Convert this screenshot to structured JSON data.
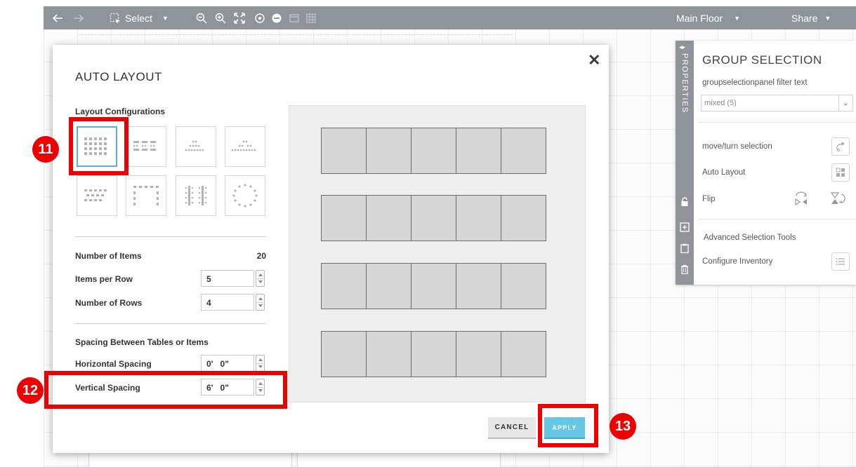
{
  "toolbar": {
    "select_label": "Select",
    "floor_label": "Main Floor",
    "share_label": "Share"
  },
  "dialog": {
    "title": "AUTO LAYOUT",
    "layout_configurations_label": "Layout Configurations",
    "number_of_items_label": "Number of Items",
    "number_of_items_value": "20",
    "items_per_row_label": "Items per Row",
    "items_per_row_value": "5",
    "number_of_rows_label": "Number of Rows",
    "number_of_rows_value": "4",
    "spacing_section_label": "Spacing Between Tables or Items",
    "horizontal_spacing_label": "Horizontal Spacing",
    "horizontal_spacing_value": "0'   0\"",
    "vertical_spacing_label": "Vertical Spacing",
    "vertical_spacing_value": "6'   0\"",
    "cancel_label": "CANCEL",
    "apply_label": "APPLY",
    "preview_rows": 4,
    "preview_columns": 5
  },
  "callouts": {
    "c11": "11",
    "c12": "12",
    "c13": "13"
  },
  "properties": {
    "tab_label": "PROPERTIES",
    "title": "GROUP SELECTION",
    "filter_label": "groupselectionpanel filter text",
    "select_value": "mixed (5)",
    "move_turn_label": "move/turn selection",
    "auto_layout_label": "Auto Layout",
    "flip_label": "Flip",
    "advanced_label": "Advanced Selection Tools",
    "configure_inventory_label": "Configure Inventory"
  },
  "colors": {
    "toolbar": "#8f949b",
    "callout": "#ee0000",
    "apply": "#66c7e5",
    "selected_tile": "#5aaee0"
  }
}
